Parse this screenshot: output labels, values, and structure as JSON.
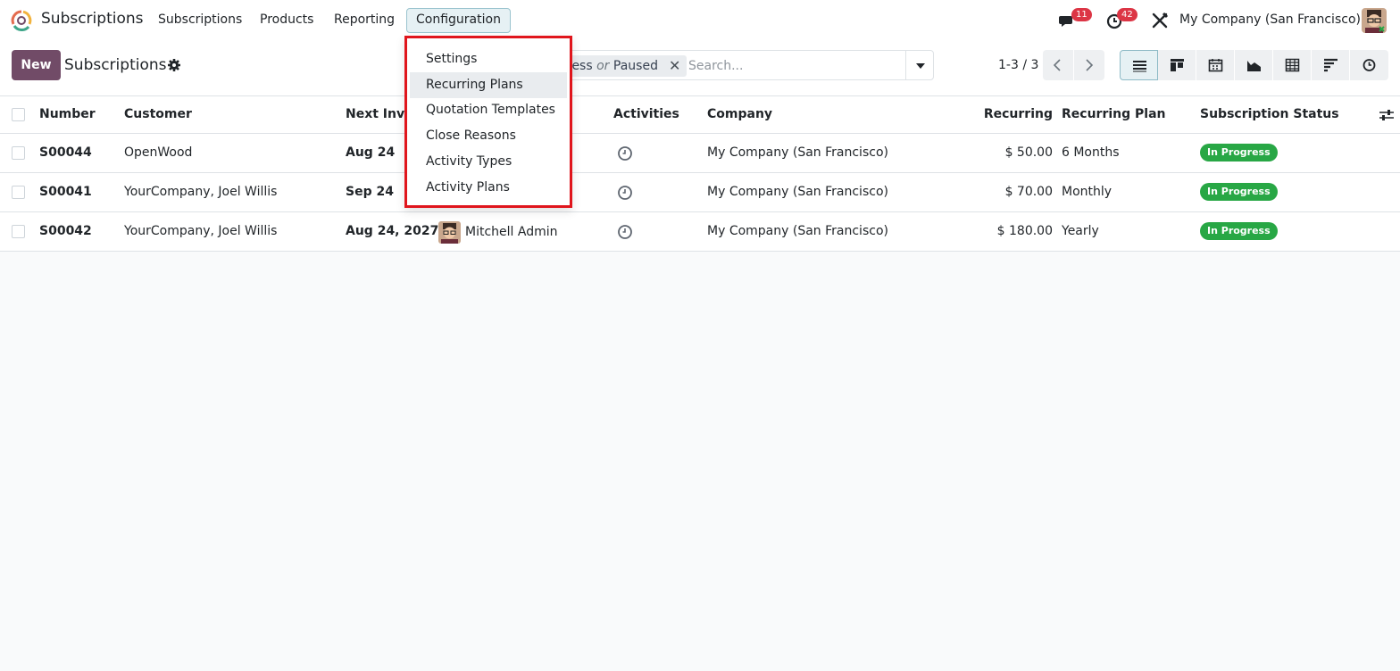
{
  "navbar": {
    "app_title": "Subscriptions",
    "menu": [
      "Subscriptions",
      "Products",
      "Reporting",
      "Configuration"
    ],
    "active_menu": "Configuration",
    "messages_count": "11",
    "activities_count": "42",
    "company": "My Company (San Francisco)"
  },
  "control": {
    "new_label": "New",
    "title": "Subscriptions",
    "facet_start": "ress",
    "facet_or": "or",
    "facet_end": "Paused",
    "facet_remove": "✕",
    "search_placeholder": "Search...",
    "pager": "1-3 / 3"
  },
  "dropdown": {
    "items": [
      "Settings",
      "Recurring Plans",
      "Quotation Templates",
      "Close Reasons",
      "Activity Types",
      "Activity Plans"
    ],
    "hovered": "Recurring Plans"
  },
  "table": {
    "headers": {
      "number": "Number",
      "customer": "Customer",
      "next_invoice": "Next Invo",
      "activities": "Activities",
      "company": "Company",
      "recurring": "Recurring",
      "plan": "Recurring Plan",
      "status": "Subscription Status"
    },
    "rows": [
      {
        "number": "S00044",
        "customer": "OpenWood",
        "next_invoice": "Aug 24",
        "salesperson": "",
        "company": "My Company (San Francisco)",
        "recurring": "$ 50.00",
        "plan": "6 Months",
        "status": "In Progress"
      },
      {
        "number": "S00041",
        "customer": "YourCompany, Joel Willis",
        "next_invoice": "Sep 24",
        "salesperson": "",
        "company": "My Company (San Francisco)",
        "recurring": "$ 70.00",
        "plan": "Monthly",
        "status": "In Progress"
      },
      {
        "number": "S00042",
        "customer": "YourCompany, Joel Willis",
        "next_invoice": "Aug 24, 2027",
        "salesperson": "Mitchell Admin",
        "company": "My Company (San Francisco)",
        "recurring": "$ 180.00",
        "plan": "Yearly",
        "status": "In Progress"
      }
    ]
  },
  "colors": {
    "brand": "#714b67",
    "status_green": "#28a745",
    "highlight_red": "#e0151c",
    "badge_red": "#dc3545"
  },
  "icons": [
    "app-logo-icon",
    "chat-icon",
    "activity-clock-icon",
    "tools-icon",
    "gear-icon",
    "chevron-left-icon",
    "chevron-right-icon",
    "list-view-icon",
    "kanban-view-icon",
    "calendar-view-icon",
    "graph-view-icon",
    "pivot-view-icon",
    "gantt-view-icon",
    "activity-view-icon",
    "column-settings-icon"
  ]
}
